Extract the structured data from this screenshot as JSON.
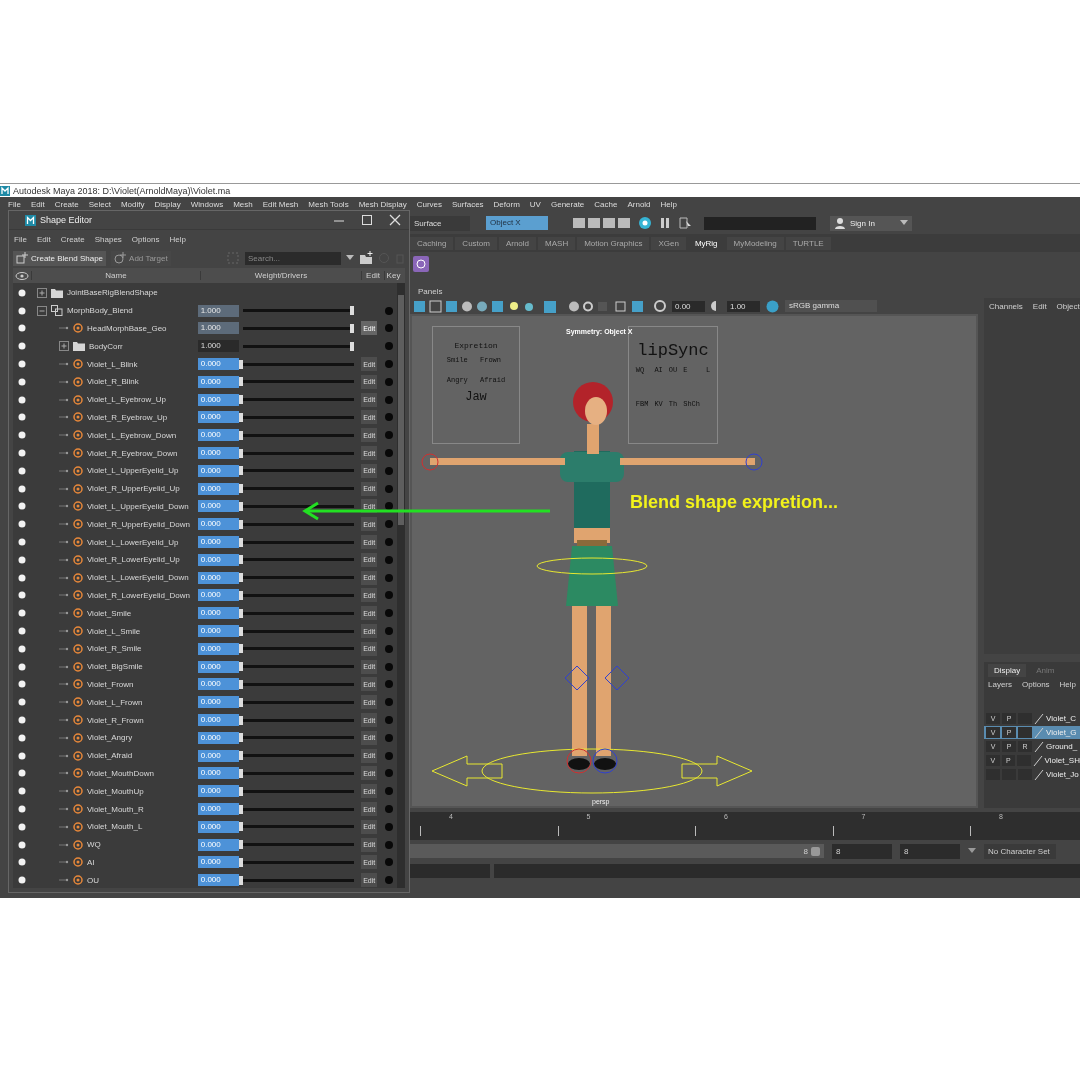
{
  "window": {
    "title": "Autodesk Maya 2018: D:\\Violet(ArnoldMaya)\\Violet.ma"
  },
  "menu": [
    "File",
    "Edit",
    "Create",
    "Select",
    "Modify",
    "Display",
    "Windows",
    "Mesh",
    "Edit Mesh",
    "Mesh Tools",
    "Mesh Display",
    "Curves",
    "Surfaces",
    "Deform",
    "UV",
    "Generate",
    "Cache",
    "Arnold",
    "Help"
  ],
  "status_line": {
    "surface_button": "Surface",
    "symmetry_field": "Object X",
    "sign_in": "Sign In"
  },
  "shelf_tabs": [
    {
      "label": "Caching",
      "selected": false
    },
    {
      "label": "Custom",
      "selected": false
    },
    {
      "label": "Arnold",
      "selected": false
    },
    {
      "label": "MASH",
      "selected": false
    },
    {
      "label": "Motion Graphics",
      "selected": false
    },
    {
      "label": "XGen",
      "selected": false
    },
    {
      "label": "MyRig",
      "selected": true
    },
    {
      "label": "MyModeling",
      "selected": false
    },
    {
      "label": "TURTLE",
      "selected": false
    }
  ],
  "shape_editor": {
    "title": "Shape Editor",
    "menu": [
      "File",
      "Edit",
      "Create",
      "Shapes",
      "Options",
      "Help"
    ],
    "create_button": "Create Blend Shape",
    "add_target": {
      "label": "Add Target",
      "disabled": true
    },
    "search_placeholder": "Search...",
    "columns": [
      "Name",
      "Weight/Drivers",
      "Edit",
      "Key"
    ],
    "rows": [
      {
        "kind": "group",
        "name": "JointBaseRigBlendShape",
        "expanded": false
      },
      {
        "kind": "blend",
        "name": "MorphBody_Blend",
        "expanded": true,
        "weight": "1.000",
        "level": 1,
        "children": [
          {
            "kind": "target",
            "name": "HeadMorphBase_Geo",
            "selected": true,
            "weight": "1.000",
            "level": 1,
            "edit": "Edit"
          },
          {
            "kind": "group",
            "name": "BodyCorr",
            "expanded": false,
            "weight": "1.000",
            "level": 1
          },
          {
            "kind": "target",
            "name": "Violet_L_Blink",
            "selected": false,
            "weight": "0.000",
            "level": 0,
            "edit": "Edit"
          },
          {
            "kind": "target",
            "name": "Violet_R_Blink",
            "selected": false,
            "weight": "0.000",
            "level": 0,
            "edit": "Edit"
          },
          {
            "kind": "target",
            "name": "Violet_L_Eyebrow_Up",
            "selected": false,
            "weight": "0.000",
            "level": 0,
            "edit": "Edit"
          },
          {
            "kind": "target",
            "name": "Violet_R_Eyebrow_Up",
            "selected": false,
            "weight": "0.000",
            "level": 0,
            "edit": "Edit"
          },
          {
            "kind": "target",
            "name": "Violet_L_Eyebrow_Down",
            "selected": false,
            "weight": "0.000",
            "level": 0,
            "edit": "Edit"
          },
          {
            "kind": "target",
            "name": "Violet_R_Eyebrow_Down",
            "selected": false,
            "weight": "0.000",
            "level": 0,
            "edit": "Edit"
          },
          {
            "kind": "target",
            "name": "Violet_L_UpperEyelid_Up",
            "selected": false,
            "weight": "0.000",
            "level": 0,
            "edit": "Edit"
          },
          {
            "kind": "target",
            "name": "Violet_R_UpperEyelid_Up",
            "selected": false,
            "weight": "0.000",
            "level": 0,
            "edit": "Edit"
          },
          {
            "kind": "target",
            "name": "Violet_L_UpperEyelid_Down",
            "selected": false,
            "weight": "0.000",
            "level": 0,
            "edit": "Edit"
          },
          {
            "kind": "target",
            "name": "Violet_R_UpperEyelid_Down",
            "selected": false,
            "weight": "0.000",
            "level": 0,
            "edit": "Edit"
          },
          {
            "kind": "target",
            "name": "Violet_L_LowerEyelid_Up",
            "selected": false,
            "weight": "0.000",
            "level": 0,
            "edit": "Edit"
          },
          {
            "kind": "target",
            "name": "Violet_R_LowerEyelid_Up",
            "selected": false,
            "weight": "0.000",
            "level": 0,
            "edit": "Edit"
          },
          {
            "kind": "target",
            "name": "Violet_L_LowerEyelid_Down",
            "selected": false,
            "weight": "0.000",
            "level": 0,
            "edit": "Edit"
          },
          {
            "kind": "target",
            "name": "Violet_R_LowerEyelid_Down",
            "selected": false,
            "weight": "0.000",
            "level": 0,
            "edit": "Edit"
          },
          {
            "kind": "target",
            "name": "Violet_Smile",
            "selected": false,
            "weight": "0.000",
            "level": 0,
            "edit": "Edit"
          },
          {
            "kind": "target",
            "name": "Violet_L_Smile",
            "selected": false,
            "weight": "0.000",
            "level": 0,
            "edit": "Edit"
          },
          {
            "kind": "target",
            "name": "Violet_R_Smile",
            "selected": false,
            "weight": "0.000",
            "level": 0,
            "edit": "Edit"
          },
          {
            "kind": "target",
            "name": "Violet_BigSmile",
            "selected": false,
            "weight": "0.000",
            "level": 0,
            "edit": "Edit"
          },
          {
            "kind": "target",
            "name": "Violet_Frown",
            "selected": false,
            "weight": "0.000",
            "level": 0,
            "edit": "Edit"
          },
          {
            "kind": "target",
            "name": "Violet_L_Frown",
            "selected": false,
            "weight": "0.000",
            "level": 0,
            "edit": "Edit"
          },
          {
            "kind": "target",
            "name": "Violet_R_Frown",
            "selected": false,
            "weight": "0.000",
            "level": 0,
            "edit": "Edit"
          },
          {
            "kind": "target",
            "name": "Violet_Angry",
            "selected": false,
            "weight": "0.000",
            "level": 0,
            "edit": "Edit"
          },
          {
            "kind": "target",
            "name": "Violet_Afraid",
            "selected": false,
            "weight": "0.000",
            "level": 0,
            "edit": "Edit"
          },
          {
            "kind": "target",
            "name": "Violet_MouthDown",
            "selected": false,
            "weight": "0.000",
            "level": 0,
            "edit": "Edit"
          },
          {
            "kind": "target",
            "name": "Violet_MouthUp",
            "selected": false,
            "weight": "0.000",
            "level": 0,
            "edit": "Edit"
          },
          {
            "kind": "target",
            "name": "Violet_Mouth_R",
            "selected": false,
            "weight": "0.000",
            "level": 0,
            "edit": "Edit"
          },
          {
            "kind": "target",
            "name": "Violet_Mouth_L",
            "selected": false,
            "weight": "0.000",
            "level": 0,
            "edit": "Edit"
          },
          {
            "kind": "target",
            "name": "WQ",
            "selected": false,
            "weight": "0.000",
            "level": 0,
            "edit": "Edit"
          },
          {
            "kind": "target",
            "name": "AI",
            "selected": false,
            "weight": "0.000",
            "level": 0,
            "edit": "Edit"
          },
          {
            "kind": "target",
            "name": "OU",
            "selected": false,
            "weight": "0.000",
            "level": 0,
            "edit": "Edit"
          }
        ]
      }
    ]
  },
  "viewport": {
    "menu": [
      "Panels"
    ],
    "exposure": "0.00",
    "gamma": "1.00",
    "color_space": "sRGB gamma",
    "symmetry": "Symmetry: Object X",
    "camera": "persp",
    "expression_panel": {
      "title": "Expretion",
      "labels": [
        "Smile",
        "Frown",
        "Angry",
        "Afraid"
      ],
      "jaw": "Jaw"
    },
    "lipsync_panel": {
      "title": "lipSync",
      "phonemes": [
        "WQ",
        "AI",
        "OU",
        "E",
        "L",
        "FBM",
        "KV",
        "Th",
        "ShCh"
      ]
    },
    "annotation": "Blend shape expretion..."
  },
  "channel_box": {
    "menu": [
      "Channels",
      "Edit",
      "Object"
    ]
  },
  "layer_editor": {
    "tabs": [
      {
        "label": "Display",
        "selected": true
      },
      {
        "label": "Anim",
        "selected": false
      }
    ],
    "menu": [
      "Layers",
      "Options",
      "Help"
    ],
    "layers": [
      {
        "flags": [
          "V",
          "P"
        ],
        "name": "Violet_C",
        "selected": false
      },
      {
        "flags": [
          "V",
          "P"
        ],
        "name": "Violet_G",
        "selected": true
      },
      {
        "flags": [
          "V",
          "P",
          "R"
        ],
        "name": "Ground_",
        "selected": false
      },
      {
        "flags": [
          "V",
          "P"
        ],
        "name": "Violet_SH",
        "selected": false
      },
      {
        "name": "Violet_Jo",
        "selected": false
      }
    ]
  },
  "timeline": {
    "ticks": [
      "4",
      "5",
      "6",
      "7",
      "8"
    ]
  },
  "range": {
    "level": 1,
    "current": "8",
    "start": "8",
    "end": "8",
    "character_set": "No Character Set"
  }
}
